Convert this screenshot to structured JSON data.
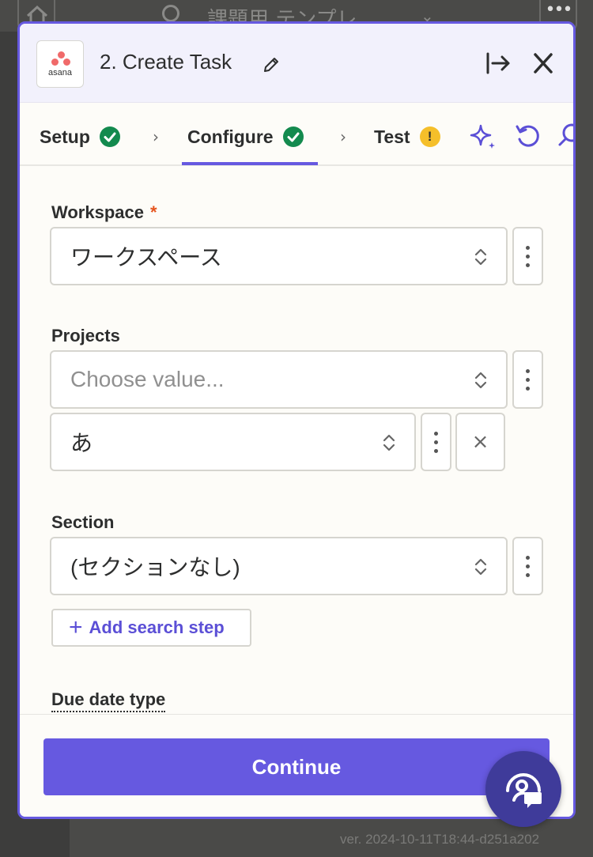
{
  "background": {
    "title": "課題用 テンプレ",
    "version": "ver. 2024-10-11T18:44-d251a202"
  },
  "header": {
    "app": "asana",
    "title": "2. Create Task",
    "icons": [
      "pencil-icon",
      "open-in-panel-icon",
      "close-icon"
    ]
  },
  "tabs": [
    {
      "label": "Setup",
      "status": "complete"
    },
    {
      "label": "Configure",
      "status": "complete",
      "active": true
    },
    {
      "label": "Test",
      "status": "warning",
      "badge": "!"
    }
  ],
  "tools": [
    "ai-sparkle-icon",
    "reset-icon",
    "search-icon"
  ],
  "form": {
    "workspace": {
      "label": "Workspace",
      "required": "*",
      "value": "ワークスペース"
    },
    "projects": {
      "label": "Projects",
      "placeholder": "Choose value...",
      "value": "あ",
      "remove": "×"
    },
    "section": {
      "label": "Section",
      "value": "(セクションなし)"
    },
    "add_search_step": "Add search step",
    "due_date_type": "Due date type"
  },
  "footer": {
    "continue": "Continue"
  },
  "colors": {
    "accent": "#6659e0",
    "success": "#138a4e",
    "warning": "#f5bf2a",
    "required": "#e5541e"
  }
}
